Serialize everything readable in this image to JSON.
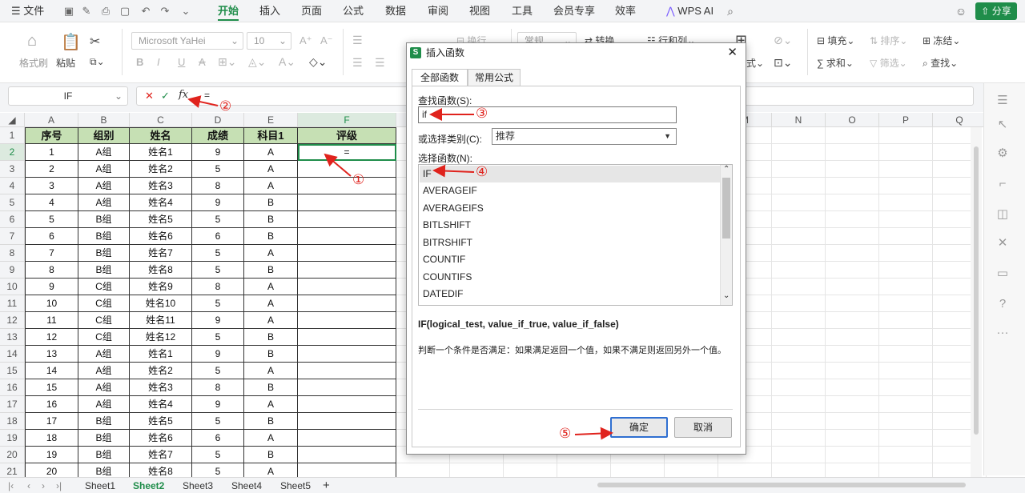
{
  "menubar": {
    "file_label": "文件",
    "tabs": [
      "开始",
      "插入",
      "页面",
      "公式",
      "数据",
      "审阅",
      "视图",
      "工具",
      "会员专享",
      "效率"
    ],
    "wps_ai": "WPS AI",
    "share": "分享"
  },
  "ribbon": {
    "format_brush": "格式刷",
    "paste": "粘贴",
    "font_name": "Microsoft YaHei",
    "font_size": "10",
    "wrap": "换行",
    "number_format": "常规",
    "convert": "转换",
    "rows_cols": "行和列",
    "fill": "填充",
    "sort": "排序",
    "freeze": "冻结",
    "sum": "求和",
    "filter": "筛选",
    "find": "查找",
    "style_label": "式"
  },
  "formula_bar": {
    "name_box": "IF",
    "formula": "="
  },
  "sheet": {
    "columns": [
      "A",
      "B",
      "C",
      "D",
      "E",
      "F",
      "G",
      "H",
      "I",
      "J",
      "K",
      "L",
      "M",
      "N",
      "O",
      "P",
      "Q"
    ],
    "header": [
      "序号",
      "组别",
      "姓名",
      "成绩",
      "科目1",
      "评级"
    ],
    "rows": [
      [
        "1",
        "A组",
        "姓名1",
        "9",
        "A",
        "="
      ],
      [
        "2",
        "A组",
        "姓名2",
        "5",
        "A",
        ""
      ],
      [
        "3",
        "A组",
        "姓名3",
        "8",
        "A",
        ""
      ],
      [
        "4",
        "A组",
        "姓名4",
        "9",
        "B",
        ""
      ],
      [
        "5",
        "B组",
        "姓名5",
        "5",
        "B",
        ""
      ],
      [
        "6",
        "B组",
        "姓名6",
        "6",
        "B",
        ""
      ],
      [
        "7",
        "B组",
        "姓名7",
        "5",
        "A",
        ""
      ],
      [
        "8",
        "B组",
        "姓名8",
        "5",
        "B",
        ""
      ],
      [
        "9",
        "C组",
        "姓名9",
        "8",
        "A",
        ""
      ],
      [
        "10",
        "C组",
        "姓名10",
        "5",
        "A",
        ""
      ],
      [
        "11",
        "C组",
        "姓名11",
        "9",
        "A",
        ""
      ],
      [
        "12",
        "C组",
        "姓名12",
        "5",
        "B",
        ""
      ],
      [
        "13",
        "A组",
        "姓名1",
        "9",
        "B",
        ""
      ],
      [
        "14",
        "A组",
        "姓名2",
        "5",
        "A",
        ""
      ],
      [
        "15",
        "A组",
        "姓名3",
        "8",
        "B",
        ""
      ],
      [
        "16",
        "A组",
        "姓名4",
        "9",
        "A",
        ""
      ],
      [
        "17",
        "B组",
        "姓名5",
        "5",
        "B",
        ""
      ],
      [
        "18",
        "B组",
        "姓名6",
        "6",
        "A",
        ""
      ],
      [
        "19",
        "B组",
        "姓名7",
        "5",
        "B",
        ""
      ],
      [
        "20",
        "B组",
        "姓名8",
        "5",
        "A",
        ""
      ]
    ],
    "row_numbers": [
      "1",
      "2",
      "3",
      "4",
      "5",
      "6",
      "7",
      "8",
      "9",
      "10",
      "11",
      "12",
      "13",
      "14",
      "15",
      "16",
      "17",
      "18",
      "19",
      "20",
      "21"
    ]
  },
  "sheet_tabs": [
    "Sheet1",
    "Sheet2",
    "Sheet3",
    "Sheet4",
    "Sheet5"
  ],
  "dialog": {
    "title": "插入函数",
    "tab_all": "全部函数",
    "tab_common": "常用公式",
    "search_label": "查找函数(S):",
    "search_value": "if",
    "category_label": "或选择类别(C):",
    "category_value": "推荐",
    "select_label": "选择函数(N):",
    "functions": [
      "IF",
      "AVERAGEIF",
      "AVERAGEIFS",
      "BITLSHIFT",
      "BITRSHIFT",
      "COUNTIF",
      "COUNTIFS",
      "DATEDIF"
    ],
    "signature": "IF(logical_test, value_if_true, value_if_false)",
    "description": "判断一个条件是否满足：如果满足返回一个值，如果不满足则返回另外一个值。",
    "ok": "确定",
    "cancel": "取消"
  },
  "annotations": [
    "①",
    "②",
    "③",
    "④",
    "⑤"
  ],
  "colors": {
    "accent": "#1f8d4a",
    "header_fill": "#c6e0b4",
    "annotation": "#e0231d"
  }
}
